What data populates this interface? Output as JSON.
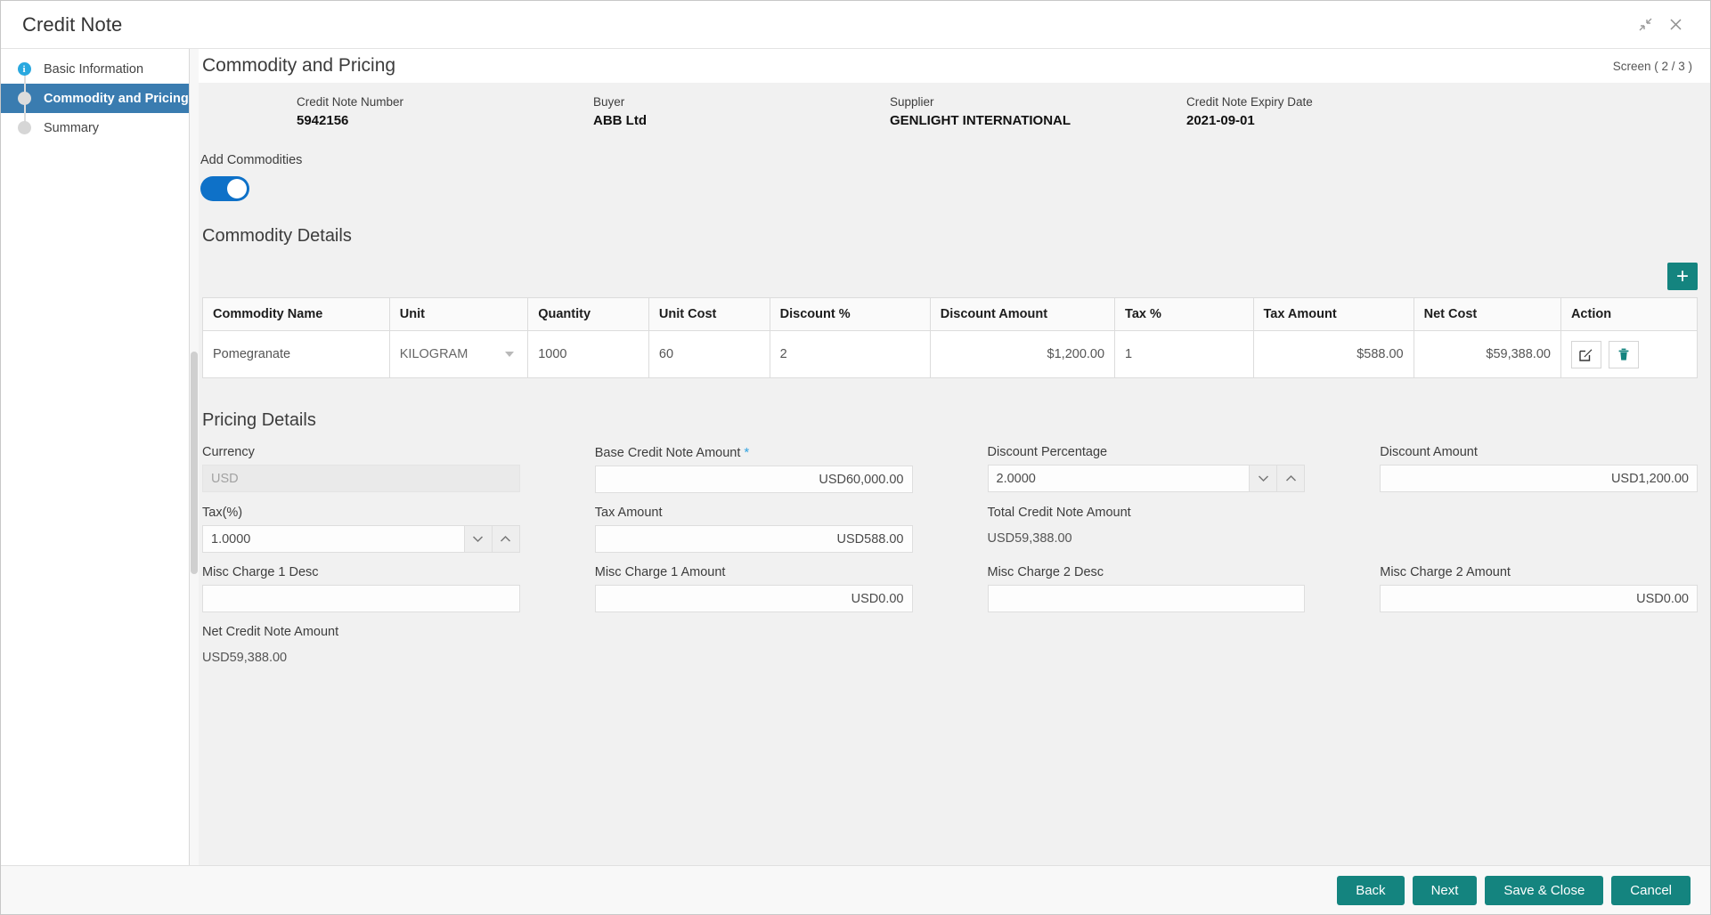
{
  "window": {
    "title": "Credit Note",
    "minimize_icon": "restore-down-icon",
    "close_icon": "close-icon"
  },
  "sidebar": {
    "items": [
      {
        "label": "Basic Information",
        "state": "completed"
      },
      {
        "label": "Commodity and Pricing",
        "state": "active"
      },
      {
        "label": "Summary",
        "state": "pending"
      }
    ]
  },
  "header": {
    "section_title": "Commodity and Pricing",
    "screen_indicator": "Screen ( 2 / 3 )"
  },
  "info_strip": [
    {
      "key": "Credit Note Number",
      "value": "5942156"
    },
    {
      "key": "Buyer",
      "value": "ABB Ltd"
    },
    {
      "key": "Supplier",
      "value": "GENLIGHT INTERNATIONAL"
    },
    {
      "key": "Credit Note Expiry Date",
      "value": "2021-09-01"
    }
  ],
  "add_commodities": {
    "label": "Add Commodities",
    "toggle_on": true
  },
  "commodity_details": {
    "title": "Commodity Details",
    "add_button_label": "+",
    "columns": [
      "Commodity Name",
      "Unit",
      "Quantity",
      "Unit Cost",
      "Discount %",
      "Discount Amount",
      "Tax %",
      "Tax Amount",
      "Net Cost",
      "Action"
    ],
    "rows": [
      {
        "commodity_name": "Pomegranate",
        "unit": "KILOGRAM",
        "quantity": "1000",
        "unit_cost": "60",
        "discount_pct": "2",
        "discount_amount": "$1,200.00",
        "tax_pct": "1",
        "tax_amount": "$588.00",
        "net_cost": "$59,388.00",
        "edit_icon": "edit-icon",
        "delete_icon": "trash-icon"
      }
    ]
  },
  "pricing_details": {
    "title": "Pricing Details",
    "fields": {
      "currency": {
        "label": "Currency",
        "value": "USD",
        "disabled": true
      },
      "base_credit_note_amount": {
        "label": "Base Credit Note Amount",
        "required": true,
        "value": "USD60,000.00"
      },
      "discount_percentage": {
        "label": "Discount Percentage",
        "value": "2.0000"
      },
      "discount_amount": {
        "label": "Discount Amount",
        "value": "USD1,200.00"
      },
      "tax_percent": {
        "label": "Tax(%)",
        "value": "1.0000"
      },
      "tax_amount": {
        "label": "Tax Amount",
        "value": "USD588.00"
      },
      "total_credit_note_amount": {
        "label": "Total Credit Note Amount",
        "value": "USD59,388.00"
      },
      "misc_charge_1_desc": {
        "label": "Misc Charge 1 Desc",
        "value": ""
      },
      "misc_charge_1_amount": {
        "label": "Misc Charge 1 Amount",
        "value": "USD0.00"
      },
      "misc_charge_2_desc": {
        "label": "Misc Charge 2 Desc",
        "value": ""
      },
      "misc_charge_2_amount": {
        "label": "Misc Charge 2 Amount",
        "value": "USD0.00"
      },
      "net_credit_note_amount": {
        "label": "Net Credit Note Amount",
        "value": "USD59,388.00"
      }
    }
  },
  "footer": {
    "buttons": [
      {
        "label": "Back"
      },
      {
        "label": "Next"
      },
      {
        "label": "Save & Close"
      },
      {
        "label": "Cancel"
      }
    ]
  },
  "colors": {
    "accent_teal": "#14847f",
    "active_blue": "#3a7cb0",
    "toggle_blue": "#0e71c8",
    "link_blue": "#2a7fd4",
    "required_star": "#33a3e0"
  }
}
